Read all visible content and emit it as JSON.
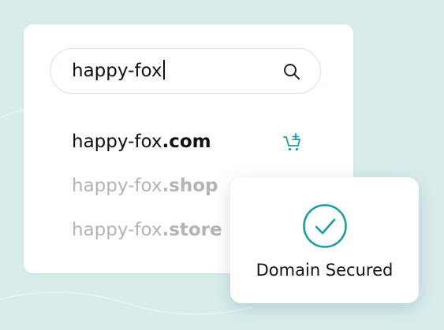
{
  "search": {
    "value": "happy-fox"
  },
  "results": [
    {
      "name": "happy-fox",
      "tld": ".com",
      "state": "available"
    },
    {
      "name": "happy-fox",
      "tld": ".shop",
      "state": "muted"
    },
    {
      "name": "happy-fox",
      "tld": ".store",
      "state": "muted"
    }
  ],
  "secured_card": {
    "label": "Domain Secured"
  },
  "icons": {
    "search": "search-icon",
    "cart": "add-to-cart-icon",
    "check": "check-circle-icon"
  },
  "colors": {
    "background": "#d8ecec",
    "accent": "#1a9ca2",
    "text": "#111111",
    "muted_text": "#b4b4b4"
  }
}
